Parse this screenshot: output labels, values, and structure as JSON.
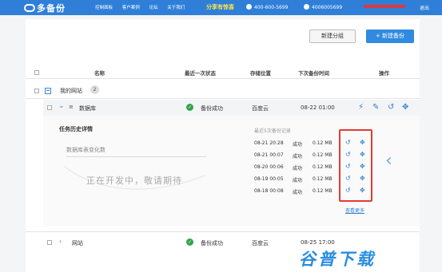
{
  "topbar": {
    "logo": "多备份",
    "nav": [
      "控制面板",
      "客户案例",
      "论坛",
      "关于我们"
    ],
    "promo": "分享有惊喜",
    "phone1": "400-600-5699",
    "phone2": "4006005699",
    "logout": "退出"
  },
  "toolbar": {
    "new_group": "新建分组",
    "new_backup": "+ 新建备份"
  },
  "table": {
    "headers": [
      "名称",
      "最近一次状态",
      "存储位置",
      "下次备份时间",
      "操作"
    ]
  },
  "group": {
    "name": "我的网站",
    "count": "2"
  },
  "rows": [
    {
      "name": "数据库",
      "status": "备份成功",
      "storage": "百度云",
      "next_time": "08-22 01:00"
    },
    {
      "name": "网站",
      "status": "备份成功",
      "storage": "百度云",
      "next_time": "08-25 17:00"
    }
  ],
  "detail": {
    "title": "任务历史详情",
    "chart_label": "数据库表变化数",
    "placeholder": "正在开发中，敬请期待",
    "history_title": "最近5次备份记录",
    "history": [
      {
        "time": "08-21 20:28",
        "status": "成功",
        "size": "0.12 MB"
      },
      {
        "time": "08-21 00:07",
        "status": "成功",
        "size": "0.12 MB"
      },
      {
        "time": "08-20 00:06",
        "status": "成功",
        "size": "0.12 MB"
      },
      {
        "time": "08-19 00:05",
        "status": "成功",
        "size": "0.12 MB"
      },
      {
        "time": "08-18 00:08",
        "status": "成功",
        "size": "0.12 MB"
      }
    ],
    "more": "查看更多"
  },
  "watermark": "谷普下载",
  "colors": {
    "accent": "#2f7fd8",
    "success": "#31a44a",
    "highlight": "#e23b34"
  }
}
